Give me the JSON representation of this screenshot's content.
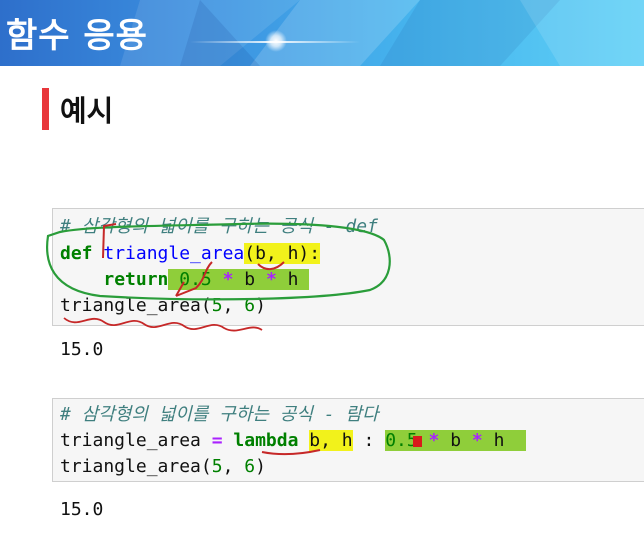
{
  "banner": {
    "title": "함수 응용"
  },
  "section": {
    "heading": "예시"
  },
  "cell1": {
    "comment": "# 삼각형의 넓이를 구하는 공식 - def",
    "line2": {
      "kw": "def",
      "fn": "triangle_area",
      "args": "(b, h):"
    },
    "line3": {
      "kw": "return",
      "num": "0.5",
      "op1": "*",
      "b": "b",
      "op2": "*",
      "h": "h"
    },
    "line4": {
      "call": "triangle_area(",
      "a1": "5",
      "sep": ", ",
      "a2": "6",
      "close": ")"
    },
    "output": "15.0"
  },
  "cell2": {
    "comment": "# 삼각형의 넓이를 구하는 공식 - 람다",
    "line2": {
      "name": "triangle_area",
      "eq": "=",
      "kw": "lambda",
      "args": "b, h",
      "colon": ":",
      "num": "0.5",
      "op1": "*",
      "b": "b",
      "op2": "*",
      "h": "h"
    },
    "line3": {
      "call": "triangle_area(",
      "a1": "5",
      "sep": ", ",
      "a2": "6",
      "close": ")"
    },
    "output": "15.0"
  },
  "colors": {
    "accent": "#e8373b",
    "banner": "#46b5ee",
    "highlight_yellow": "#f2f21b",
    "highlight_green": "#8fce3a",
    "pen_green": "#2a9d3a",
    "pen_red": "#c62828"
  }
}
